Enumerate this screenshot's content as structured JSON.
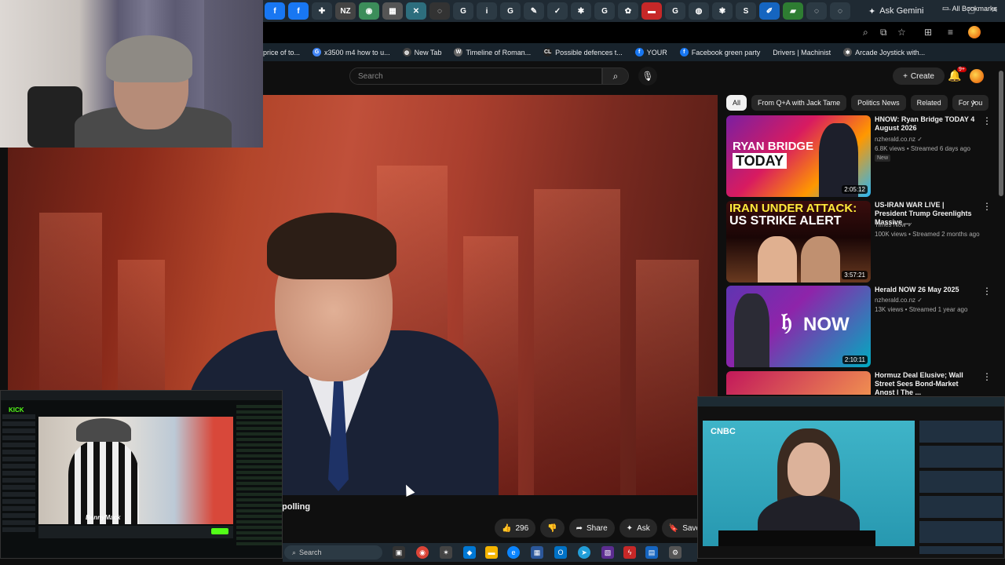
{
  "browser": {
    "ask_gemini": "Ask Gemini",
    "tab_icons": [
      {
        "name": "facebook-tab",
        "glyph": "f",
        "color": "#1877f2"
      },
      {
        "name": "facebook-tab-2",
        "glyph": "f",
        "color": "#1877f2"
      },
      {
        "name": "ext-tab",
        "glyph": "✚",
        "color": "#2c3a44"
      },
      {
        "name": "nz-tab",
        "glyph": "NZ",
        "color": "#444"
      },
      {
        "name": "chrome-tab",
        "glyph": "◉",
        "color": "#3c8d5a"
      },
      {
        "name": "app-tab",
        "glyph": "▦",
        "color": "#555"
      },
      {
        "name": "tool-tab",
        "glyph": "✕",
        "color": "#2d6e7e"
      },
      {
        "name": "search-tab",
        "glyph": "◌",
        "color": "#333"
      },
      {
        "name": "google-tab",
        "glyph": "G",
        "color": "#2c3a44"
      },
      {
        "name": "info-tab",
        "glyph": "i",
        "color": "#2c3a44"
      },
      {
        "name": "google-tab-2",
        "glyph": "G",
        "color": "#2c3a44"
      },
      {
        "name": "pen-tab",
        "glyph": "✎",
        "color": "#2c3a44"
      },
      {
        "name": "check-tab",
        "glyph": "✓",
        "color": "#2c3a44"
      },
      {
        "name": "spider-tab",
        "glyph": "✱",
        "color": "#2c3a44"
      },
      {
        "name": "google-tab-3",
        "glyph": "G",
        "color": "#2c3a44"
      },
      {
        "name": "gear-tab",
        "glyph": "✿",
        "color": "#2c3a44"
      },
      {
        "name": "red-tab",
        "glyph": "▬",
        "color": "#c62828"
      },
      {
        "name": "google-tab-4",
        "glyph": "G",
        "color": "#2c3a44"
      },
      {
        "name": "globe-tab",
        "glyph": "◍",
        "color": "#2c3a44"
      },
      {
        "name": "bug-tab",
        "glyph": "✾",
        "color": "#2c3a44"
      },
      {
        "name": "s-tab",
        "glyph": "S",
        "color": "#2c3a44"
      },
      {
        "name": "edit-tab",
        "glyph": "✐",
        "color": "#1565c0"
      },
      {
        "name": "green-tab",
        "glyph": "▰",
        "color": "#2e7d32"
      },
      {
        "name": "grey-tab",
        "glyph": "◌",
        "color": "#2c3a44"
      },
      {
        "name": "grey-tab-2",
        "glyph": "◌",
        "color": "#2c3a44"
      }
    ],
    "bookmarks": [
      {
        "label": "price of to...",
        "icon": "",
        "color": "#1f2a33"
      },
      {
        "label": "x3500 m4 how to u...",
        "icon": "G",
        "color": "#4285f4"
      },
      {
        "label": "New Tab",
        "icon": "◍",
        "color": "#444"
      },
      {
        "label": "Timeline of Roman...",
        "icon": "W",
        "color": "#666"
      },
      {
        "label": "Possible defences t...",
        "icon": "CL",
        "color": "#222"
      },
      {
        "label": "YOUR",
        "icon": "f",
        "color": "#1877f2"
      },
      {
        "label": "Facebook green party",
        "icon": "f",
        "color": "#1877f2"
      },
      {
        "label": "Drivers | Machinist",
        "icon": "",
        "color": "#1f2a33"
      },
      {
        "label": "Arcade Joystick with...",
        "icon": "✱",
        "color": "#555"
      }
    ],
    "all_bookmarks": "All Bookmarks"
  },
  "youtube": {
    "search_placeholder": "Search",
    "create_label": "Create",
    "notification_count": "9+",
    "title_fragment": "polling",
    "actions": {
      "likes": "296",
      "share": "Share",
      "ask": "Ask",
      "save": "Save"
    },
    "chips": [
      "All",
      "From Q+A with Jack Tame",
      "Politics News",
      "Related",
      "For you"
    ],
    "recommendations": [
      {
        "title": "HNOW: Ryan Bridge TODAY 4 August 2026",
        "channel": "nzherald.co.nz ✓",
        "meta": "6.8K views • Streamed 6 days ago",
        "badge": "New",
        "duration": "2:05:12",
        "thumb_text": "RYAN BRIDGE",
        "thumb_sub": "TODAY"
      },
      {
        "title": "US-IRAN WAR LIVE | President Trump Greenlights Massive ...",
        "channel": "Times Now ✓",
        "meta": "100K views • Streamed 2 months ago",
        "badge": "",
        "duration": "3:57:21",
        "thumb_text": "IRAN UNDER ATTACK:",
        "thumb_sub": "US STRIKE ALERT"
      },
      {
        "title": "Herald NOW 26 May 2025",
        "channel": "nzherald.co.nz ✓",
        "meta": "13K views • Streamed 1 year ago",
        "badge": "",
        "duration": "2:10:11",
        "thumb_text": "NOW",
        "thumb_sub": ""
      },
      {
        "title": "Hormuz Deal Elusive; Wall Street Sees Bond-Market Angst | The ...",
        "channel": "",
        "meta": "",
        "badge": "",
        "duration": "",
        "thumb_text": "",
        "thumb_sub": ""
      }
    ]
  },
  "overlays": {
    "kick_logo": "KICK",
    "kick_streamer": "BennyMack",
    "cnbc_logo": "CNBC"
  },
  "taskbar": {
    "search_label": "Search"
  },
  "colors": {
    "youtube_bg": "#0f0f0f",
    "kick_green": "#53fc18",
    "notification_red": "#cc0000"
  }
}
